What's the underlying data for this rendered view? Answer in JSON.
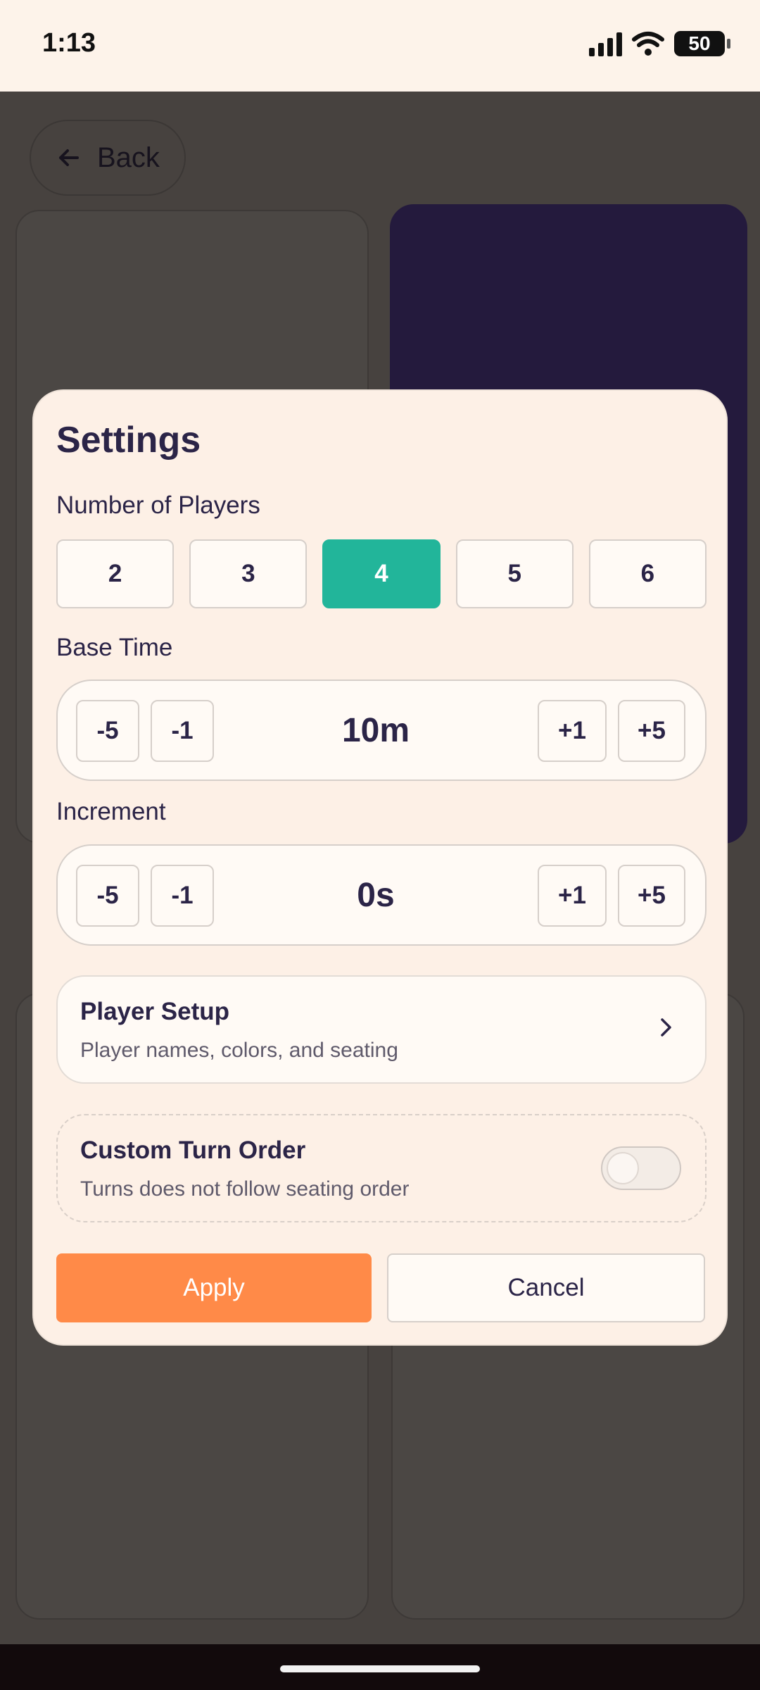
{
  "status_bar": {
    "time": "1:13",
    "battery": "50"
  },
  "background": {
    "back_label": "Back"
  },
  "settings": {
    "title": "Settings",
    "players_label": "Number of Players",
    "player_options": [
      "2",
      "3",
      "4",
      "5",
      "6"
    ],
    "selected_players": "4",
    "base_time_label": "Base Time",
    "base_time_value": "10m",
    "increment_label": "Increment",
    "increment_value": "0s",
    "step_buttons": [
      "-5",
      "-1",
      "+1",
      "+5"
    ],
    "player_setup": {
      "title": "Player Setup",
      "subtitle": "Player names, colors, and seating"
    },
    "custom_turn_order": {
      "title": "Custom Turn Order",
      "subtitle": "Turns does not follow seating order",
      "enabled": false
    },
    "apply_label": "Apply",
    "cancel_label": "Cancel"
  },
  "colors": {
    "accent_selected": "#22b59a",
    "apply_button": "#ff8a48",
    "modal_background": "#fdf0e6",
    "text_primary": "#2b2447"
  }
}
